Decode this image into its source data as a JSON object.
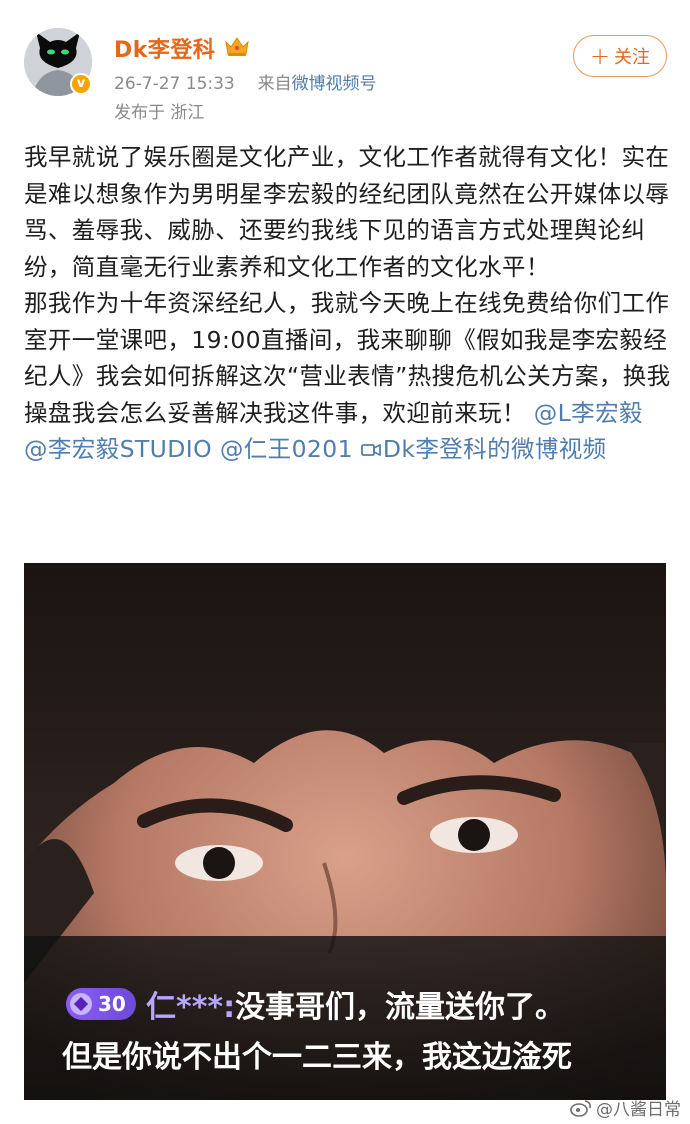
{
  "post": {
    "author": "Dk李登科",
    "timestamp": "26-7-27 15:33",
    "source_prefix": "来自",
    "source": "微博视频号",
    "location": "发布于 浙江",
    "follow_label": "关注",
    "follow_plus": "+",
    "verified_mark": "v",
    "text": {
      "p1": "我早就说了娱乐圈是文化产业，文化工作者就得有文化！实在是难以想象作为男明星李宏毅的经纪团队竟然在公开媒体以辱骂、羞辱我、威胁、还要约我线下见的语言方式处理舆论纠纷，简直毫无行业素养和文化工作者的文化水平！",
      "p2": "那我作为十年资深经纪人，我就今天晚上在线免费给你们工作室开一堂课吧，19:00直播间，我来聊聊《假如我是李宏毅经纪人》我会如何拆解这次“营业表情”热搜危机公关方案，换我操盘我会怎么妥善解决我这件事，欢迎前来玩！",
      "mention1": "@L李宏毅",
      "mention2": "@李宏毅STUDIO",
      "mention3": "@仁王0201",
      "video_link": "Dk李登科的微博视频"
    },
    "icons": {
      "avatar": "avatar-black-cat-mask",
      "crown": "crown-icon",
      "video": "video-icon"
    }
  },
  "media": {
    "badge_level": "30",
    "chat_user": "仁***:",
    "chat_line1": "没事哥们，流量送你了。",
    "chat_line2": "但是你说不出个一二三来，我这边淦死"
  },
  "watermark": {
    "label": "@八酱日常"
  },
  "colors": {
    "name": "#e5681a",
    "link": "#507daf",
    "meta": "#8a8a8a",
    "badge": "#7c4dff"
  }
}
